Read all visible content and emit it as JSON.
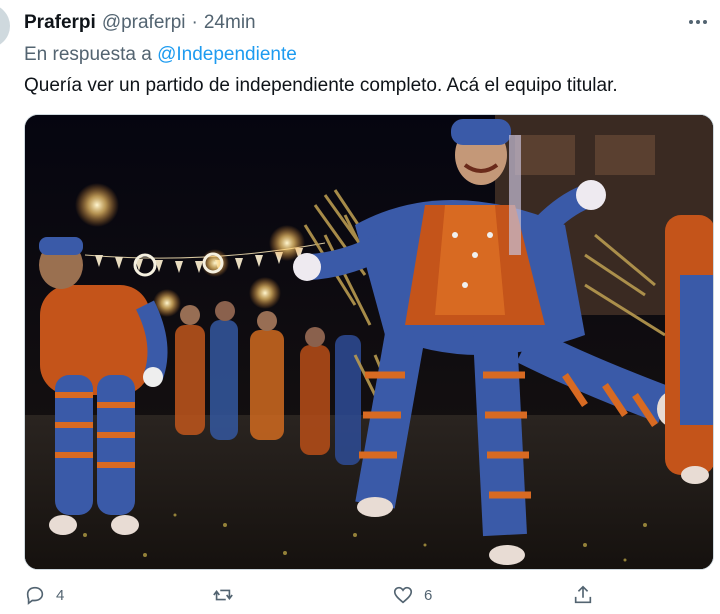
{
  "tweet": {
    "display_name": "Praferpi",
    "handle": "@praferpi",
    "separator": "·",
    "time": "24min",
    "reply_prefix": "En respuesta a",
    "reply_mention": "@Independiente",
    "text": "Quería ver un partido de independiente completo. Acá el equipo titular."
  },
  "media": {
    "description_icon": "photo-carnival-dancers"
  },
  "actions": {
    "reply_count": "4",
    "retweet_count": "",
    "like_count": "6"
  },
  "colors": {
    "link": "#1d9bf0",
    "secondary": "#536471",
    "primary": "#0f1419"
  }
}
